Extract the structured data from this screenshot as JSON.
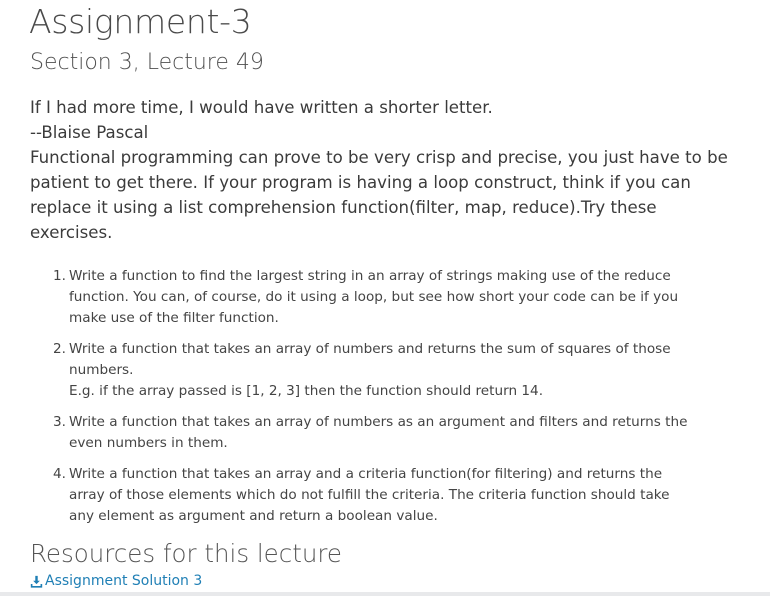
{
  "title": "Assignment-3",
  "subtitle": "Section 3, Lecture 49",
  "intro": {
    "quote": "If I had more time, I would have written a shorter letter.",
    "quote_author": "--Blaise Pascal",
    "paragraph": "Functional programming can prove to be very crisp and precise, you just have to be patient to get there. If your program is having a loop construct, think if you can replace it using a list comprehension function(filter, map, reduce).Try these exercises."
  },
  "exercises": [
    {
      "number": "1.",
      "text": "Write a function to find the largest string in an array of strings making use of the reduce function. You can, of course, do it using a loop, but see how short your code can be if you make use of the filter function."
    },
    {
      "number": "2.",
      "text": "Write a function that takes an array of numbers and returns the sum of squares of those numbers.",
      "example": "E.g. if the array passed is [1, 2, 3] then the function should return 14."
    },
    {
      "number": "3.",
      "text": "Write a function that takes an array of numbers as an argument and filters and returns the even numbers in them."
    },
    {
      "number": "4.",
      "text": "Write a function that takes an array and a criteria function(for filtering) and returns the array of those elements which do not fulfill the criteria. The criteria function should take any element as argument and return a boolean value."
    }
  ],
  "resources": {
    "heading": "Resources for this lecture",
    "links": [
      {
        "label": "Assignment Solution 3",
        "icon": "download-icon"
      }
    ]
  },
  "colors": {
    "link": "#1f7fb5",
    "text": "#3b3b3b",
    "bottom_bar": "#e8e9eb"
  }
}
